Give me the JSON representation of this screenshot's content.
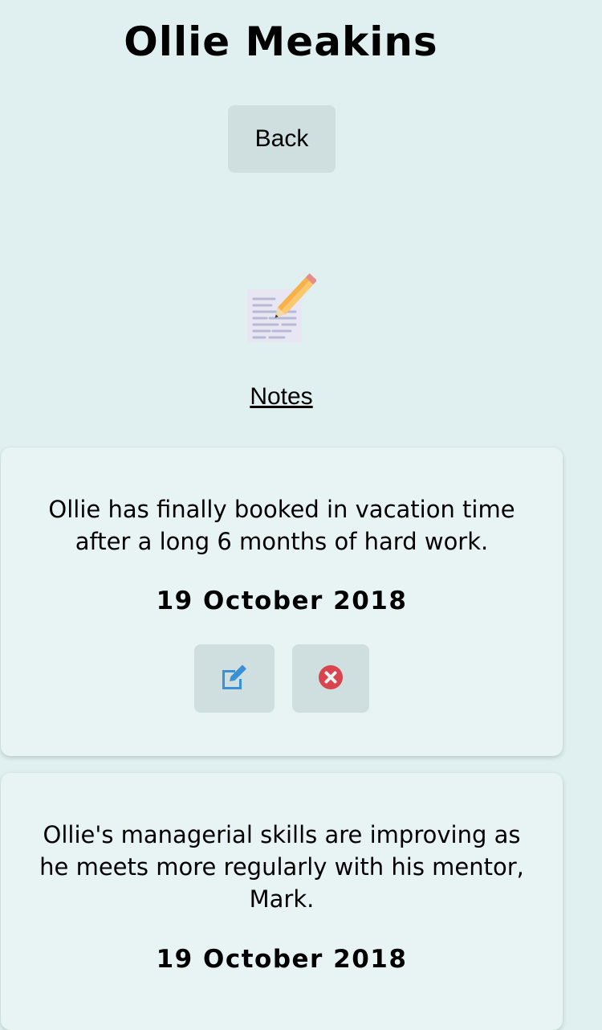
{
  "header": {
    "title": "Ollie Meakins",
    "back_label": "Back"
  },
  "section": {
    "icon": "notes-icon",
    "link_label": "Notes"
  },
  "notes": [
    {
      "text": "Ollie has finally booked in vacation time after a long 6 months of hard work.",
      "date": "19 October 2018",
      "actions": [
        "edit-icon",
        "delete-icon"
      ]
    },
    {
      "text": "Ollie's managerial skills are improving as he meets more regularly with his mentor, Mark.",
      "date": "19 October 2018"
    }
  ],
  "colors": {
    "background": "#e0f0f0",
    "card": "#e8f4f4",
    "button": "#cfdfdf",
    "edit_icon": "#3b8fd4",
    "delete_icon": "#d9444f"
  }
}
